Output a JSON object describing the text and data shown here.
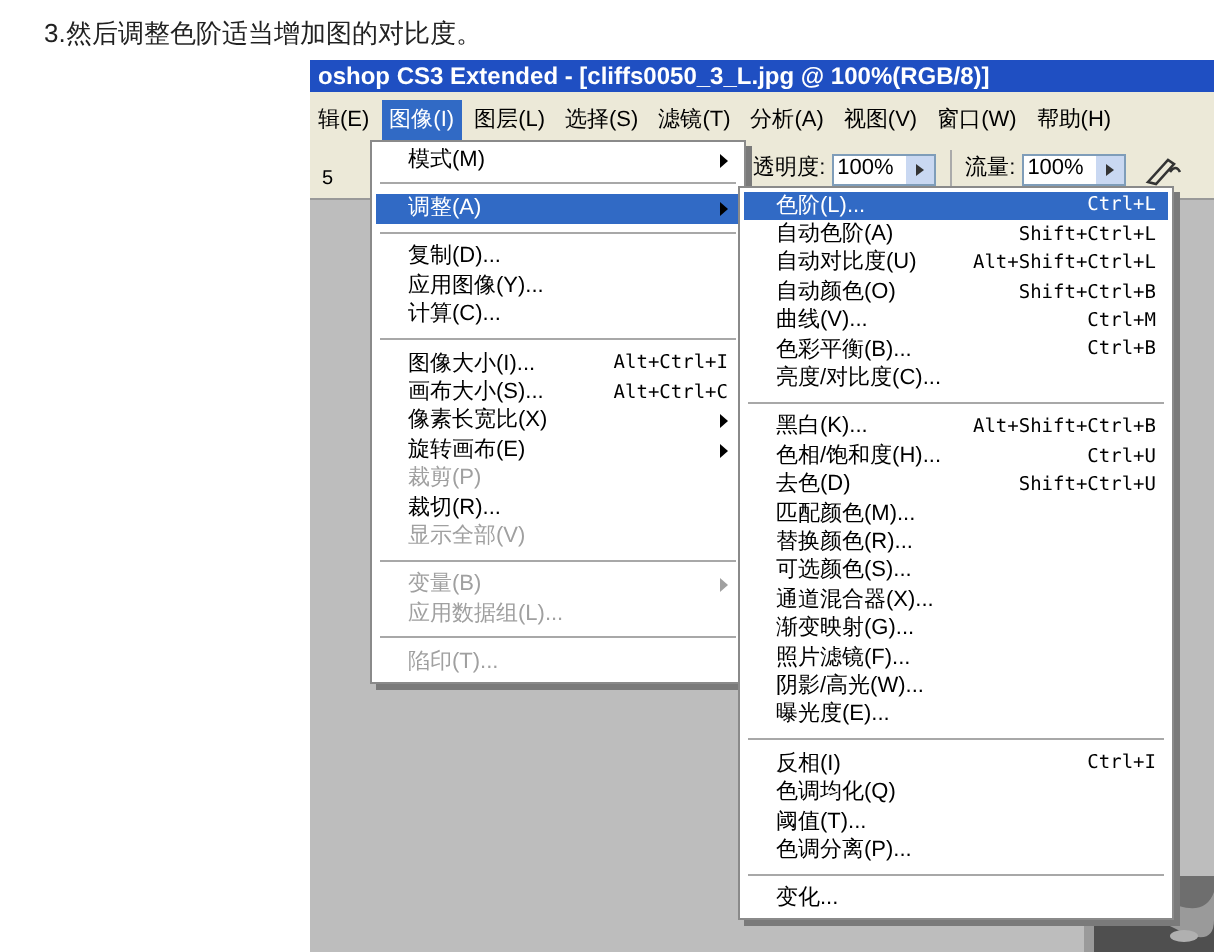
{
  "caption": "3.然后调整色阶适当增加图的对比度。",
  "app": {
    "title": "oshop CS3 Extended - [cliffs0050_3_L.jpg @ 100%(RGB/8)]",
    "menubar": [
      {
        "label": "辑(E)",
        "selected": false
      },
      {
        "label": "图像(I)",
        "selected": true
      },
      {
        "label": "图层(L)",
        "selected": false
      },
      {
        "label": "选择(S)",
        "selected": false
      },
      {
        "label": "滤镜(T)",
        "selected": false
      },
      {
        "label": "分析(A)",
        "selected": false
      },
      {
        "label": "视图(V)",
        "selected": false
      },
      {
        "label": "窗口(W)",
        "selected": false
      },
      {
        "label": "帮助(H)",
        "selected": false
      }
    ],
    "options": {
      "brush_size": "5",
      "opacity_label": "透明度:",
      "opacity": "100%",
      "flow_label": "流量:",
      "flow": "100%"
    }
  },
  "image_menu": {
    "items": [
      {
        "kind": "item",
        "label": "模式(M)",
        "submenu": true,
        "disabled": false,
        "selected": false
      },
      {
        "kind": "separator"
      },
      {
        "kind": "item",
        "label": "调整(A)",
        "submenu": true,
        "disabled": false,
        "selected": true
      },
      {
        "kind": "separator"
      },
      {
        "kind": "item",
        "label": "复制(D)...",
        "submenu": false,
        "disabled": false,
        "selected": false
      },
      {
        "kind": "item",
        "label": "应用图像(Y)...",
        "submenu": false,
        "disabled": false,
        "selected": false
      },
      {
        "kind": "item",
        "label": "计算(C)...",
        "submenu": false,
        "disabled": false,
        "selected": false
      },
      {
        "kind": "separator"
      },
      {
        "kind": "item",
        "label": "图像大小(I)...",
        "shortcut": "Alt+Ctrl+I",
        "submenu": false,
        "disabled": false,
        "selected": false
      },
      {
        "kind": "item",
        "label": "画布大小(S)...",
        "shortcut": "Alt+Ctrl+C",
        "submenu": false,
        "disabled": false,
        "selected": false
      },
      {
        "kind": "item",
        "label": "像素长宽比(X)",
        "submenu": true,
        "disabled": false,
        "selected": false
      },
      {
        "kind": "item",
        "label": "旋转画布(E)",
        "submenu": true,
        "disabled": false,
        "selected": false
      },
      {
        "kind": "item",
        "label": "裁剪(P)",
        "submenu": false,
        "disabled": true,
        "selected": false
      },
      {
        "kind": "item",
        "label": "裁切(R)...",
        "submenu": false,
        "disabled": false,
        "selected": false
      },
      {
        "kind": "item",
        "label": "显示全部(V)",
        "submenu": false,
        "disabled": true,
        "selected": false
      },
      {
        "kind": "separator"
      },
      {
        "kind": "item",
        "label": "变量(B)",
        "submenu": true,
        "disabled": true,
        "selected": false
      },
      {
        "kind": "item",
        "label": "应用数据组(L)...",
        "submenu": false,
        "disabled": true,
        "selected": false
      },
      {
        "kind": "separator"
      },
      {
        "kind": "item",
        "label": "陷印(T)...",
        "submenu": false,
        "disabled": true,
        "selected": false
      }
    ]
  },
  "adjust_submenu": {
    "items": [
      {
        "kind": "item",
        "label": "色阶(L)...",
        "shortcut": "Ctrl+L",
        "selected": true
      },
      {
        "kind": "item",
        "label": "自动色阶(A)",
        "shortcut": "Shift+Ctrl+L",
        "selected": false
      },
      {
        "kind": "item",
        "label": "自动对比度(U)",
        "shortcut": "Alt+Shift+Ctrl+L",
        "selected": false
      },
      {
        "kind": "item",
        "label": "自动颜色(O)",
        "shortcut": "Shift+Ctrl+B",
        "selected": false
      },
      {
        "kind": "item",
        "label": "曲线(V)...",
        "shortcut": "Ctrl+M",
        "selected": false
      },
      {
        "kind": "item",
        "label": "色彩平衡(B)...",
        "shortcut": "Ctrl+B",
        "selected": false
      },
      {
        "kind": "item",
        "label": "亮度/对比度(C)...",
        "selected": false
      },
      {
        "kind": "separator"
      },
      {
        "kind": "item",
        "label": "黑白(K)...",
        "shortcut": "Alt+Shift+Ctrl+B",
        "selected": false
      },
      {
        "kind": "item",
        "label": "色相/饱和度(H)...",
        "shortcut": "Ctrl+U",
        "selected": false
      },
      {
        "kind": "item",
        "label": "去色(D)",
        "shortcut": "Shift+Ctrl+U",
        "selected": false
      },
      {
        "kind": "item",
        "label": "匹配颜色(M)...",
        "selected": false
      },
      {
        "kind": "item",
        "label": "替换颜色(R)...",
        "selected": false
      },
      {
        "kind": "item",
        "label": "可选颜色(S)...",
        "selected": false
      },
      {
        "kind": "item",
        "label": "通道混合器(X)...",
        "selected": false
      },
      {
        "kind": "item",
        "label": "渐变映射(G)...",
        "selected": false
      },
      {
        "kind": "item",
        "label": "照片滤镜(F)...",
        "selected": false
      },
      {
        "kind": "item",
        "label": "阴影/高光(W)...",
        "selected": false
      },
      {
        "kind": "item",
        "label": "曝光度(E)...",
        "selected": false
      },
      {
        "kind": "separator"
      },
      {
        "kind": "item",
        "label": "反相(I)",
        "shortcut": "Ctrl+I",
        "selected": false
      },
      {
        "kind": "item",
        "label": "色调均化(Q)",
        "selected": false
      },
      {
        "kind": "item",
        "label": "阈值(T)...",
        "selected": false
      },
      {
        "kind": "item",
        "label": "色调分离(P)...",
        "selected": false
      },
      {
        "kind": "separator"
      },
      {
        "kind": "item",
        "label": "变化...",
        "selected": false
      }
    ]
  }
}
